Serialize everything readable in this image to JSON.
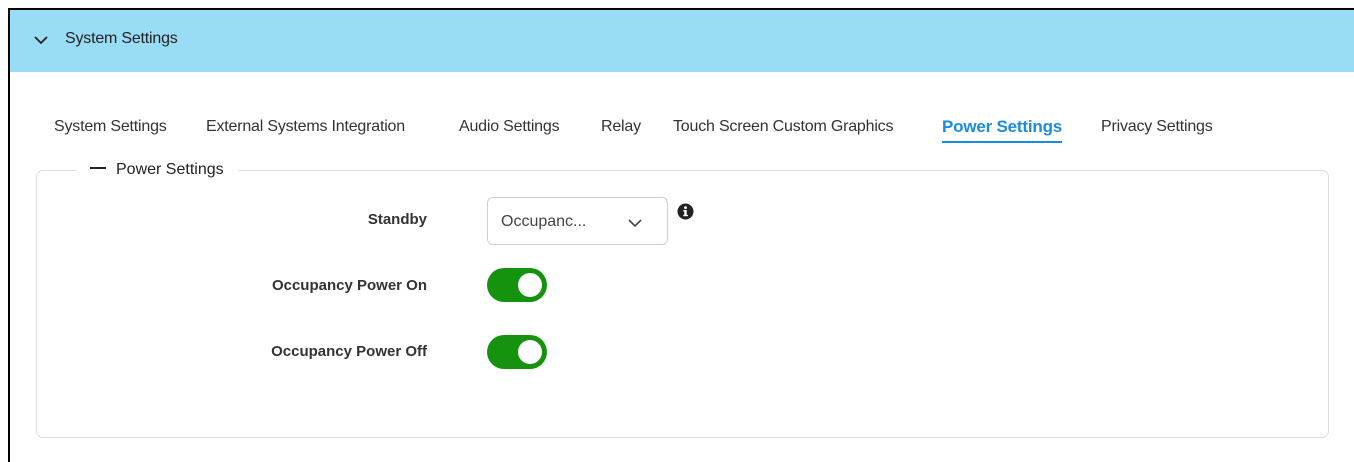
{
  "header": {
    "title": "System Settings",
    "collapse_icon": "chevron-down-icon",
    "background": "#99dcf5"
  },
  "tabs": [
    {
      "label": "System Settings",
      "active": false
    },
    {
      "label": "External Systems Integration",
      "active": false
    },
    {
      "label": "Audio Settings",
      "active": false
    },
    {
      "label": "Relay",
      "active": false
    },
    {
      "label": "Touch Screen Custom Graphics",
      "active": false
    },
    {
      "label": "Power Settings",
      "active": true
    },
    {
      "label": "Privacy Settings",
      "active": false
    }
  ],
  "accent_color": "#1a8cde",
  "power_settings": {
    "legend": "Power Settings",
    "standby": {
      "label": "Standby",
      "value": "Occupanc...",
      "info_icon": "info-circle-icon"
    },
    "occupancy_power_on": {
      "label": "Occupancy Power On",
      "checked": true
    },
    "occupancy_power_off": {
      "label": "Occupancy Power Off",
      "checked": true
    },
    "toggle_color": "#16930e"
  }
}
